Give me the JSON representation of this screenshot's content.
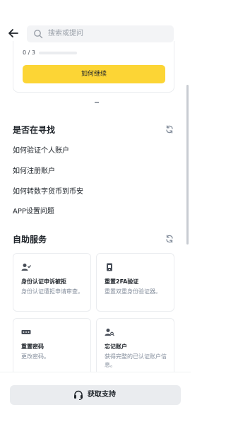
{
  "search": {
    "placeholder": "搜索或提问"
  },
  "progress_card": {
    "count_text": "0 / 3",
    "progress_fraction": 0,
    "continue_label": "如何继续"
  },
  "looking_for": {
    "title": "是否在寻找",
    "items": [
      "如何验证个人账户",
      "如何注册账户",
      "如何转数字货币到币安",
      "APP设置问题"
    ]
  },
  "self_service": {
    "title": "自助服务",
    "cards": [
      {
        "icon": "user-check-icon",
        "title": "身份认证申诉被拒",
        "desc": "身份认证遭拒申请审查。"
      },
      {
        "icon": "phone-2fa-icon",
        "title": "重置2FA验证",
        "desc": "重置双重身份验证器。"
      },
      {
        "icon": "password-icon",
        "title": "重置密码",
        "desc": "更改密码。"
      },
      {
        "icon": "user-search-icon",
        "title": "忘记账户",
        "desc": "获得完整的已认证账户信息。"
      }
    ]
  },
  "support": {
    "label": "获取支持",
    "icon": "headset-icon"
  },
  "colors": {
    "accent": "#fcd535",
    "text": "#1e2329",
    "muted": "#848e9c"
  }
}
